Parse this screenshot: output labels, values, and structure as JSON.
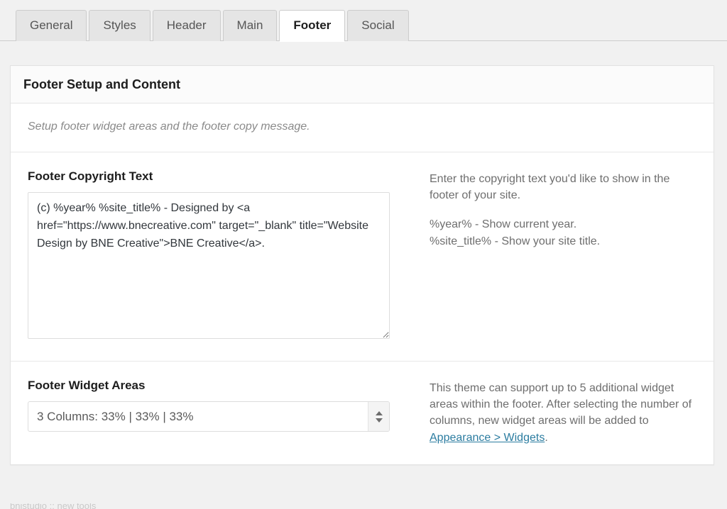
{
  "tabs": [
    {
      "label": "General",
      "active": false
    },
    {
      "label": "Styles",
      "active": false
    },
    {
      "label": "Header",
      "active": false
    },
    {
      "label": "Main",
      "active": false
    },
    {
      "label": "Footer",
      "active": true
    },
    {
      "label": "Social",
      "active": false
    }
  ],
  "panel": {
    "title": "Footer Setup and Content",
    "intro": "Setup footer widget areas and the footer copy message."
  },
  "copyright_field": {
    "label": "Footer Copyright Text",
    "value": "(c) %year% %site_title% - Designed by <a href=\"https://www.bnecreative.com\" target=\"_blank\" title=\"Website Design by BNE Creative\">BNE Creative</a>.",
    "help_primary": "Enter the copyright text you'd like to show in the footer of your site.",
    "help_token_year": "%year% - Show current year.",
    "help_token_site_title": "%site_title% - Show your site title."
  },
  "widget_areas_field": {
    "label": "Footer Widget Areas",
    "selected": "3 Columns: 33% | 33% | 33%",
    "help_before_link": "This theme can support up to 5 additional widget areas within the footer. After selecting the number of columns, new widget areas will be added to ",
    "help_link_text": "Appearance > Widgets",
    "help_after_link": "."
  },
  "colors": {
    "page_background": "#f1f1f1",
    "panel_background": "#ffffff",
    "link": "#2b7ca0",
    "text_primary": "#1d1d1d",
    "text_muted": "#6e6e6e"
  },
  "bottom_sliver": {
    "text": "bnistudio :: new tools"
  }
}
